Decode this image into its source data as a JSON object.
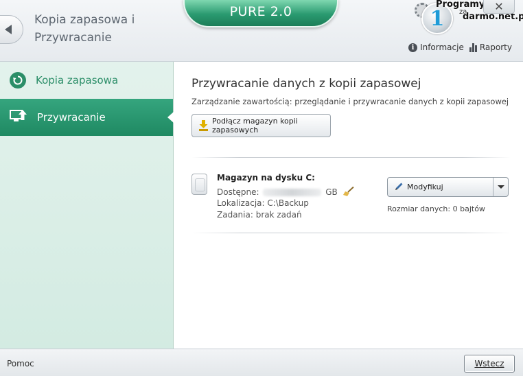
{
  "header": {
    "title": "Kopia zapasowa i Przywracanie",
    "brand": "PURE 2.0",
    "close_glyph": "✕",
    "links": [
      {
        "icon": "info-icon",
        "label": "Informacje"
      },
      {
        "icon": "reports-icon",
        "label": "Raporty"
      }
    ]
  },
  "watermark": {
    "line1": "Programy",
    "line2": "za",
    "line3": "darmo.net.pl",
    "badge": "1"
  },
  "sidebar": {
    "items": [
      {
        "label": "Kopia zapasowa",
        "icon": "backup-refresh-icon",
        "active": false
      },
      {
        "label": "Przywracanie",
        "icon": "restore-monitor-icon",
        "active": true
      }
    ]
  },
  "main": {
    "title": "Przywracanie danych z kopii zapasowej",
    "subtitle": "Zarządzanie zawartością: przeglądanie i przywracanie danych z kopii zapasowej",
    "connect_button": "Podłącz magazyn kopii zapasowych",
    "storage": {
      "name": "Magazyn na dysku C:",
      "available_label": "Dostępne:",
      "available_unit": "GB",
      "location": "Lokalizacja: C:\\Backup",
      "tasks": "Zadania: brak zadań",
      "modify_button": "Modyfikuj",
      "data_size": "Rozmiar danych: 0 bajtów"
    }
  },
  "footer": {
    "help": "Pomoc",
    "back": "Wstecz"
  },
  "colors": {
    "accent": "#2b8e68",
    "active_item": "#279470",
    "sidebar_bg": "#dcefe7"
  }
}
